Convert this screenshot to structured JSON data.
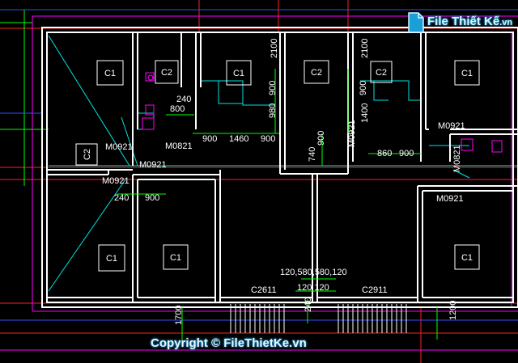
{
  "watermark": {
    "logo_text": "File Thiết Kế",
    "logo_suffix": ".vn",
    "copyright": "Copyright © FileThietKe.vn"
  },
  "rooms": {
    "c1_top_left": "C1",
    "c2_top_wc": "C2",
    "c1_top_mid": "C1",
    "c2_top_right": "C2",
    "c2_stair_right": "C2",
    "c1_top_far_right": "C1",
    "c2_left_wall": "C2",
    "c1_bottom_left": "C1",
    "c1_bottom_mid_left": "C1",
    "c1_bottom_right": "C1"
  },
  "doors": {
    "m0821_wc": "M0821",
    "m0921_left": "M0921",
    "m0921_left_lower": "M0921",
    "m0921_bottom_left": "M0921",
    "m0921_center": "M0921",
    "m0921_right_top": "M0921",
    "m0821_right": "M0821",
    "m0921_right_bottom": "M0921"
  },
  "windows": {
    "c2611": "C2611",
    "c2911": "C2911"
  },
  "dimensions": {
    "d240_a": "240",
    "d800": "800",
    "d900_a": "900",
    "d1460": "1460",
    "d900_b": "900",
    "d2100_a": "2100",
    "d900_v": "900",
    "d980": "980",
    "d2100_b": "2100",
    "d900_v2": "900",
    "d1400": "1400",
    "d740": "740",
    "d900_v3": "900",
    "d860": "860",
    "d900_c": "900",
    "d240_b": "240",
    "d900_d": "900",
    "d120_580_580_120": "120,580,580,120",
    "d120_120": "120 120",
    "d1700": "1700",
    "d240_v": "240",
    "d1200": "1200"
  },
  "colors": {
    "background": "#000000",
    "wall": "#ffffff",
    "axis_red": "#ff2020",
    "magenta": "#ff00ff",
    "cyan": "#00e5e5",
    "green": "#00ff00",
    "blue_dim": "#3050ff"
  }
}
